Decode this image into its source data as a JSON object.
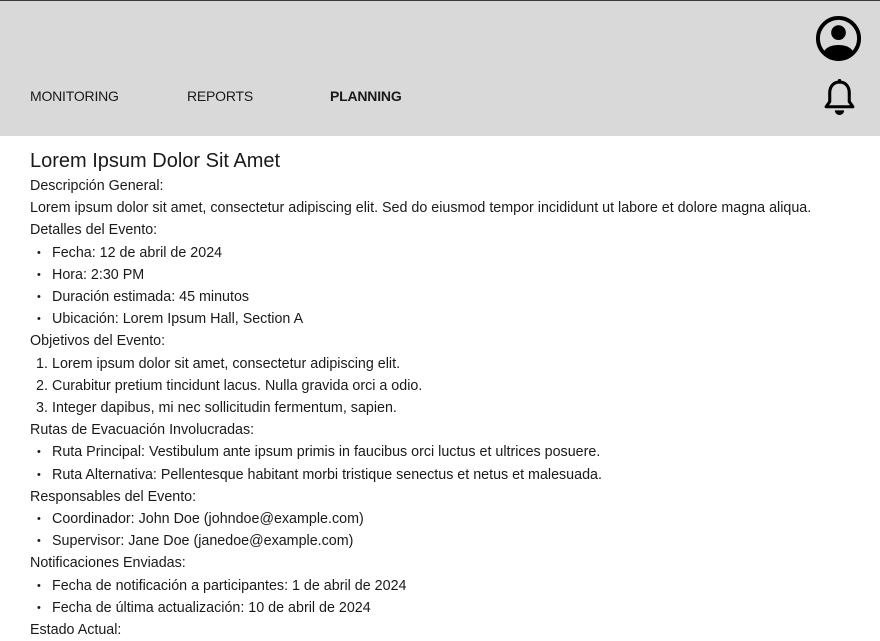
{
  "nav": {
    "items": [
      {
        "label": "MONITORING",
        "active": false
      },
      {
        "label": "REPORTS",
        "active": false
      },
      {
        "label": "PLANNING",
        "active": true
      }
    ]
  },
  "header": {
    "icons": [
      "user-profile-icon",
      "notification-bell-icon"
    ]
  },
  "event": {
    "title": "Lorem Ipsum Dolor Sit Amet",
    "description_heading": "Descripción General:",
    "description": "Lorem ipsum dolor sit amet, consectetur adipiscing elit. Sed do eiusmod tempor incididunt ut labore et dolore magna aliqua.",
    "details_heading": "Detalles del Evento:",
    "details": [
      "Fecha: 12 de abril de 2024",
      "Hora: 2:30 PM",
      "Duración estimada: 45 minutos",
      "Ubicación: Lorem Ipsum Hall, Section A"
    ],
    "objectives_heading": "Objetivos del Evento:",
    "objectives": [
      {
        "n": "1.",
        "text": "Lorem ipsum dolor sit amet, consectetur adipiscing elit."
      },
      {
        "n": "2.",
        "text": "Curabitur pretium tincidunt lacus. Nulla gravida orci a odio."
      },
      {
        "n": "3.",
        "text": "Integer dapibus, mi nec sollicitudin fermentum, sapien."
      }
    ],
    "routes_heading": "Rutas de Evacuación Involucradas:",
    "routes": [
      "Ruta Principal: Vestibulum ante ipsum primis in faucibus orci luctus et ultrices posuere.",
      "Ruta Alternativa: Pellentesque habitant morbi tristique senectus et netus et malesuada."
    ],
    "responsibles_heading": "Responsables del Evento:",
    "responsibles": [
      "Coordinador: John Doe (johndoe@example.com)",
      "Supervisor: Jane Doe (janedoe@example.com)"
    ],
    "notifications_heading": "Notificaciones Enviadas:",
    "notifications": [
      "Fecha de notificación a participantes: 1 de abril de 2024",
      "Fecha de última actualización: 10 de abril de 2024"
    ],
    "status_heading": "Estado Actual:"
  }
}
